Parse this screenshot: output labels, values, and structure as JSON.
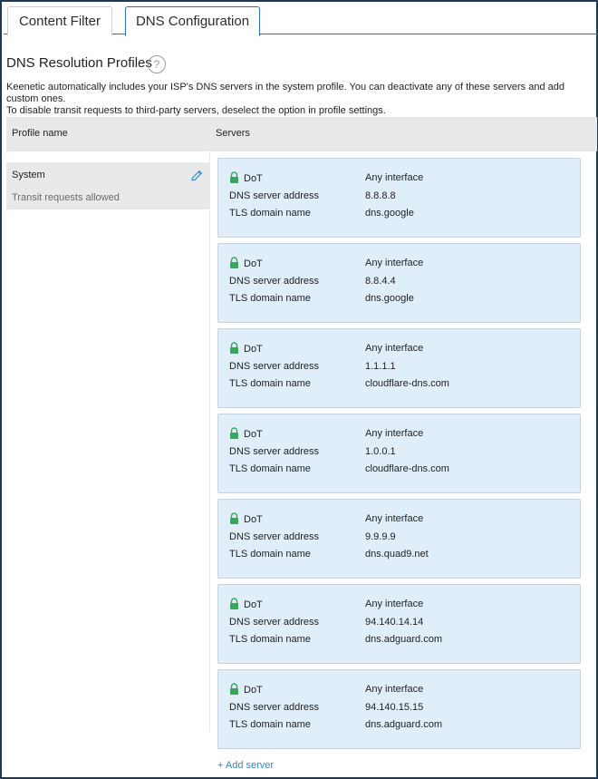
{
  "tabs": [
    {
      "label": "Content Filter",
      "active": false
    },
    {
      "label": "DNS Configuration",
      "active": true
    }
  ],
  "section": {
    "title": "DNS Resolution Profiles",
    "help_icon": "?",
    "description_line1": "Keenetic automatically includes your ISP's DNS servers in the system profile. You can deactivate any of these servers and add custom ones.",
    "description_line2": "To disable transit requests to third-party servers, deselect the option in profile settings."
  },
  "table": {
    "col_profile": "Profile name",
    "col_servers": "Servers"
  },
  "profile": {
    "name": "System",
    "subtitle": "Transit requests allowed",
    "edit_icon": "pencil-icon"
  },
  "servers": [
    {
      "protocol": "DoT",
      "interface": "Any interface",
      "address_label": "DNS server address",
      "address": "8.8.8.8",
      "tls_label": "TLS domain name",
      "tls": "dns.google"
    },
    {
      "protocol": "DoT",
      "interface": "Any interface",
      "address_label": "DNS server address",
      "address": "8.8.4.4",
      "tls_label": "TLS domain name",
      "tls": "dns.google"
    },
    {
      "protocol": "DoT",
      "interface": "Any interface",
      "address_label": "DNS server address",
      "address": "1.1.1.1",
      "tls_label": "TLS domain name",
      "tls": "cloudflare-dns.com"
    },
    {
      "protocol": "DoT",
      "interface": "Any interface",
      "address_label": "DNS server address",
      "address": "1.0.0.1",
      "tls_label": "TLS domain name",
      "tls": "cloudflare-dns.com"
    },
    {
      "protocol": "DoT",
      "interface": "Any interface",
      "address_label": "DNS server address",
      "address": "9.9.9.9",
      "tls_label": "TLS domain name",
      "tls": "dns.quad9.net"
    },
    {
      "protocol": "DoT",
      "interface": "Any interface",
      "address_label": "DNS server address",
      "address": "94.140.14.14",
      "tls_label": "TLS domain name",
      "tls": "dns.adguard.com"
    },
    {
      "protocol": "DoT",
      "interface": "Any interface",
      "address_label": "DNS server address",
      "address": "94.140.15.15",
      "tls_label": "TLS domain name",
      "tls": "dns.adguard.com"
    }
  ],
  "add_server_label": "+ Add server",
  "colors": {
    "accent": "#2f86c8",
    "card_bg": "#dfeef8",
    "lock": "#3aa55d",
    "header_bg": "#e7e9eb"
  }
}
